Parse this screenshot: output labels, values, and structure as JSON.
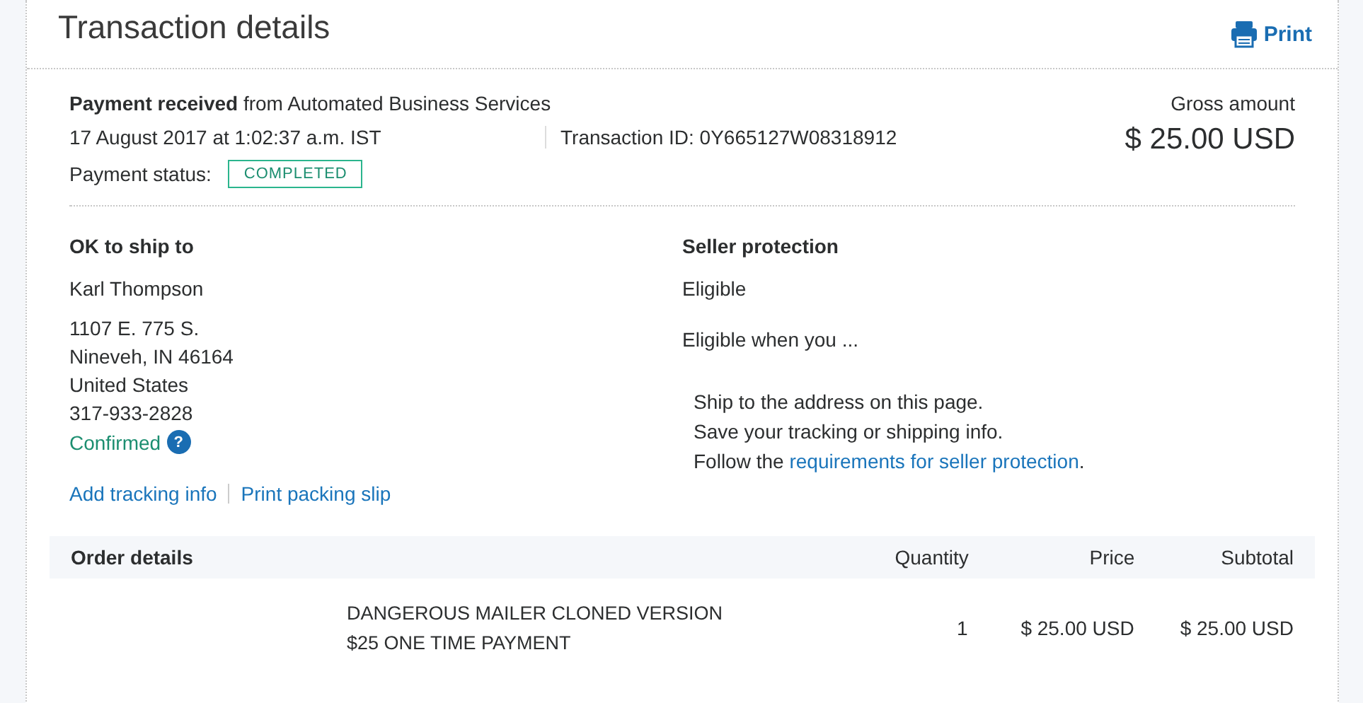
{
  "title": "Transaction details",
  "print_label": "Print",
  "summary": {
    "headline": "**Payment received** from Automated Business Services",
    "date": "17 August 2017 at 1:02:37 a.m. IST",
    "transaction_id": "Transaction ID: 0Y665127W08318912",
    "status_label": "Payment status:",
    "status": "COMPLETED",
    "gross_label": "Gross amount",
    "gross_amount": "$ 25.00 USD"
  },
  "ship_to": {
    "heading": "OK to ship to",
    "name": "Karl Thompson",
    "address_lines": [
      "1107 E. 775 S.",
      "Nineveh, IN 46164",
      "United States",
      "317-933-2828"
    ],
    "confirmed": "Confirmed",
    "help_icon": "?",
    "links": [
      "Add tracking info",
      "Print packing slip"
    ]
  },
  "seller_protection": {
    "heading": "Seller protection",
    "status": "Eligible",
    "intro": "Eligible when you ...",
    "steps": [
      {
        "text": "Ship to the address on this page."
      },
      {
        "text": "Save your tracking or shipping info."
      },
      {
        "text": "Follow the ",
        "link": "requirements for seller protection",
        "after": "."
      }
    ]
  },
  "order": {
    "columns": [
      "Order details",
      "Quantity",
      "Price",
      "Subtotal"
    ],
    "rows": [
      {
        "item": "DANGEROUS MAILER CLONED VERSION $25 ONE TIME PAYMENT",
        "quantity": "1",
        "price": "$ 25.00 USD",
        "subtotal": "$ 25.00 USD"
      }
    ]
  }
}
